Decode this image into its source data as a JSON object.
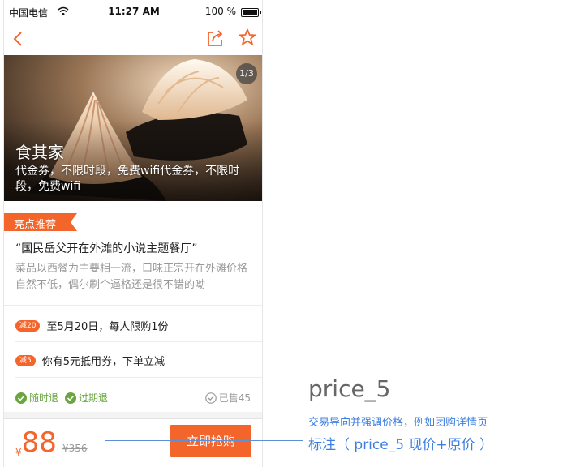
{
  "status_bar": {
    "carrier": "中国电信",
    "time": "11:27 AM",
    "battery": "100 %"
  },
  "colors": {
    "accent": "#f4652c",
    "green": "#6aa640",
    "annotation": "#3d7fe0"
  },
  "hero": {
    "counter": "1/3",
    "title": "食其家",
    "subtitle": "代金券，不限时段，免费wifi代金券，不限时段，免费wifi"
  },
  "highlights": {
    "tag": "亮点推荐",
    "quote": "“国民岳父开在外滩的小说主题餐厅”",
    "description": "菜品以西餐为主要相一流，口味正宗开在外滩价格自然不低，偶尔刷个逼格还是很不错的呦"
  },
  "promos": [
    {
      "badge": "减20",
      "text": "至5月20日，每人限购1份"
    },
    {
      "badge": "减5",
      "text": "你有5元抵用券，下单立减"
    }
  ],
  "guarantees": [
    "随时退",
    "过期退"
  ],
  "sold": "已售45",
  "price": {
    "currency": "¥",
    "current": "88",
    "original_currency": "¥",
    "original": "356"
  },
  "buy_button": "立即抢购",
  "annotation": {
    "title": "price_5",
    "line1": "交易导向并强调价格，例如团购详情页",
    "line2": "标注（ price_5 现价+原价 ）"
  }
}
